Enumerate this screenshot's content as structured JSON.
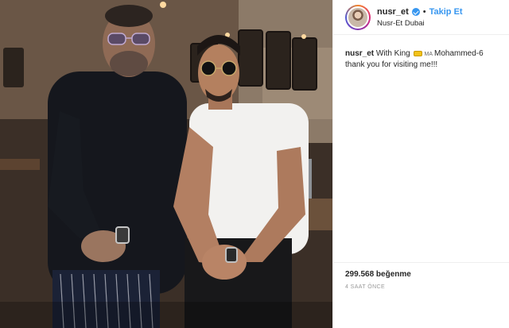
{
  "header": {
    "username": "nusr_et",
    "separator": "•",
    "follow_label": "Takip Et",
    "location": "Nusr-Et Dubai"
  },
  "caption": {
    "username": "nusr_et",
    "text_before": "With King",
    "tag_prefix": "MA",
    "text_after": "Mohammed-6",
    "line2": "thank you for visiting me!!!"
  },
  "stats": {
    "likes": "299.568 beğenme",
    "time_ago": "4 SAAT ÖNCE"
  },
  "colors": {
    "accent": "#3897f0",
    "text": "#262626",
    "muted": "#999999",
    "border": "#efefef"
  }
}
